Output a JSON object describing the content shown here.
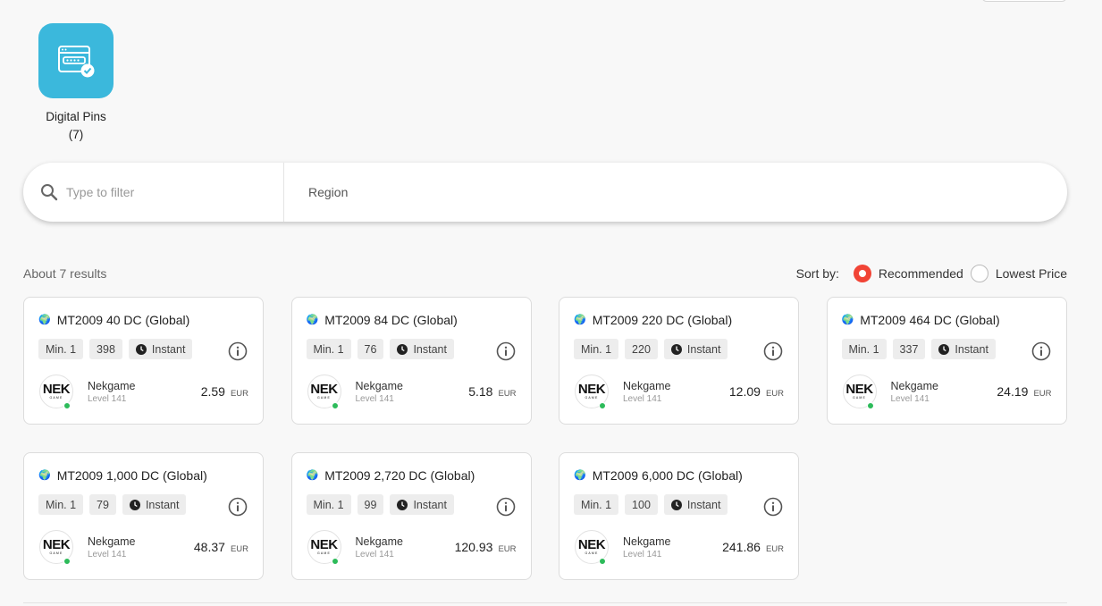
{
  "category": {
    "label": "Digital Pins",
    "count": "(7)"
  },
  "filter": {
    "placeholder": "Type to filter",
    "region_label": "Region"
  },
  "results": {
    "count_text": "About 7 results"
  },
  "sort": {
    "label": "Sort by:",
    "options": [
      {
        "label": "Recommended",
        "selected": true
      },
      {
        "label": "Lowest Price",
        "selected": false
      }
    ]
  },
  "colors": {
    "accent": "#f14436",
    "category_tile": "#3bb8dc",
    "online": "#2dbb5a"
  },
  "products": [
    {
      "title": "MT2009 40 DC (Global)",
      "min": "Min. 1",
      "stock": "398",
      "delivery": "Instant",
      "seller": "Nekgame",
      "level": "Level 141",
      "price": "2.59",
      "currency": "EUR"
    },
    {
      "title": "MT2009 84 DC (Global)",
      "min": "Min. 1",
      "stock": "76",
      "delivery": "Instant",
      "seller": "Nekgame",
      "level": "Level 141",
      "price": "5.18",
      "currency": "EUR"
    },
    {
      "title": "MT2009 220 DC (Global)",
      "min": "Min. 1",
      "stock": "220",
      "delivery": "Instant",
      "seller": "Nekgame",
      "level": "Level 141",
      "price": "12.09",
      "currency": "EUR"
    },
    {
      "title": "MT2009 464 DC (Global)",
      "min": "Min. 1",
      "stock": "337",
      "delivery": "Instant",
      "seller": "Nekgame",
      "level": "Level 141",
      "price": "24.19",
      "currency": "EUR"
    },
    {
      "title": "MT2009 1,000 DC (Global)",
      "min": "Min. 1",
      "stock": "79",
      "delivery": "Instant",
      "seller": "Nekgame",
      "level": "Level 141",
      "price": "48.37",
      "currency": "EUR"
    },
    {
      "title": "MT2009 2,720 DC (Global)",
      "min": "Min. 1",
      "stock": "99",
      "delivery": "Instant",
      "seller": "Nekgame",
      "level": "Level 141",
      "price": "120.93",
      "currency": "EUR"
    },
    {
      "title": "MT2009 6,000 DC (Global)",
      "min": "Min. 1",
      "stock": "100",
      "delivery": "Instant",
      "seller": "Nekgame",
      "level": "Level 141",
      "price": "241.86",
      "currency": "EUR"
    }
  ],
  "seller_logo": {
    "text": "NEK",
    "sub": "GAME"
  },
  "icons": {
    "globe": "🌍"
  }
}
